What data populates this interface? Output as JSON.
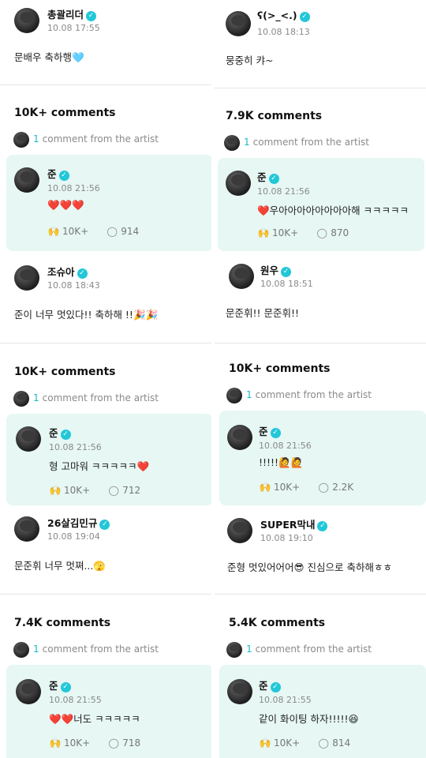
{
  "top_posts": [
    {
      "author": "총괄리더",
      "date": "10.08 17:55",
      "text": "문배우 축하행🩵"
    },
    {
      "author": "ʕ(>_<.)",
      "date": "10.08 18:13",
      "text": "뭉중히 캬~"
    }
  ],
  "from_artist_label": "comment from the artist",
  "threads": [
    {
      "count": "10K+ comments",
      "from_count": "1",
      "reply": {
        "author": "준",
        "date": "10.08 21:56",
        "text": "❤️❤️❤️",
        "likes": "10K+",
        "comments": "914"
      },
      "post": {
        "author": "조슈아",
        "date": "10.08 18:43",
        "text": "준이 너무 멋있다!! 축하해 !!🎉🎉"
      }
    },
    {
      "count": "7.9K comments",
      "from_count": "1",
      "reply": {
        "author": "준",
        "date": "10.08 21:56",
        "text": "❤️우아아아아아아아아해 ㅋㅋㅋㅋㅋ",
        "likes": "10K+",
        "comments": "870"
      },
      "post": {
        "author": "원우",
        "date": "10.08 18:51",
        "text": "문준휘!! 문준휘!!"
      }
    },
    {
      "count": "10K+ comments",
      "from_count": "1",
      "reply": {
        "author": "준",
        "date": "10.08 21:56",
        "text": "형 고마워 ㅋㅋㅋㅋㅋ❤️",
        "likes": "10K+",
        "comments": "712"
      },
      "post": {
        "author": "26살김민규",
        "date": "10.08 19:04",
        "text": "문준휘 너무 멋쪄...🫣"
      }
    },
    {
      "count": "10K+ comments",
      "from_count": "1",
      "reply": {
        "author": "준",
        "date": "10.08 21:56",
        "text": "!!!!!🙋🙋",
        "likes": "10K+",
        "comments": "2.2K"
      },
      "post": {
        "author": "SUPER막내",
        "date": "10.08 19:10",
        "text": "준형 멋있어어어😎 진심으로 축하해ㅎㅎ"
      }
    },
    {
      "count": "7.4K comments",
      "from_count": "1",
      "reply": {
        "author": "준",
        "date": "10.08 21:55",
        "text": "❤️❤️너도 ㅋㅋㅋㅋㅋ",
        "likes": "10K+",
        "comments": "718"
      },
      "post": null
    },
    {
      "count": "5.4K comments",
      "from_count": "1",
      "reply": {
        "author": "준",
        "date": "10.08 21:55",
        "text": "같이 화이팅 하자!!!!!😆",
        "likes": "10K+",
        "comments": "814"
      },
      "post": null
    }
  ],
  "icons": {
    "verified": "verified-check-icon",
    "like": "like-hands-icon",
    "comment": "comment-bubble-icon"
  },
  "colors": {
    "verified": "#22c7d8",
    "reply_bg": "#e6f7f4",
    "accent": "#18b8c9"
  }
}
